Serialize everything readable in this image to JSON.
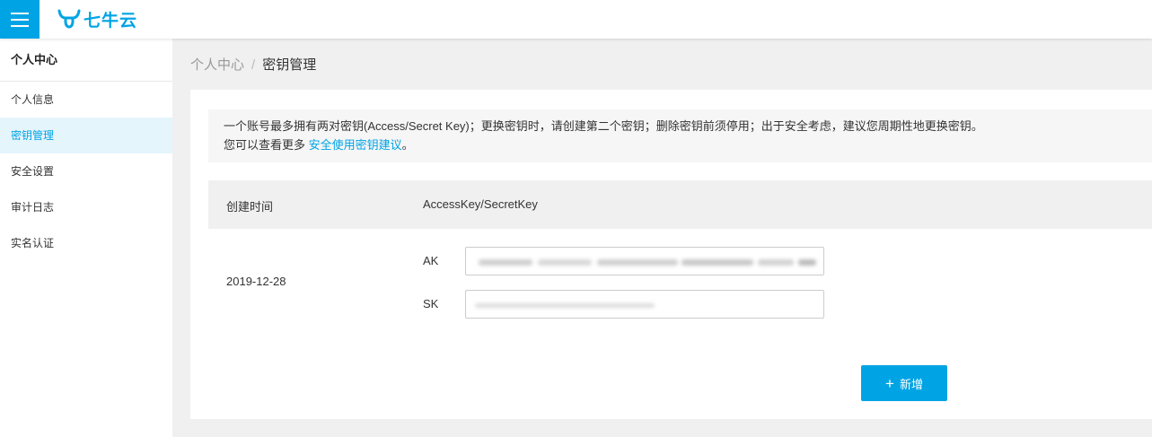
{
  "header": {
    "logo_text": "七牛云",
    "brand_color": "#00a4e4",
    "menu_icon": "hamburger-menu-icon",
    "logo_icon": "bull-head-icon"
  },
  "sidebar": {
    "title": "个人中心",
    "items": [
      {
        "label": "个人信息",
        "active": false
      },
      {
        "label": "密钥管理",
        "active": true
      },
      {
        "label": "安全设置",
        "active": false
      },
      {
        "label": "审计日志",
        "active": false
      },
      {
        "label": "实名认证",
        "active": false
      }
    ]
  },
  "breadcrumb": {
    "parent": "个人中心",
    "separator": "/",
    "current": "密钥管理"
  },
  "notice": {
    "line1": "一个账号最多拥有两对密钥(Access/Secret Key)；更换密钥时，请创建第二个密钥；删除密钥前须停用；出于安全考虑，建议您周期性地更换密钥。",
    "line2_prefix": "您可以查看更多 ",
    "line2_link": "安全使用密钥建议",
    "line2_suffix": "。"
  },
  "table": {
    "headers": [
      "创建时间",
      "AccessKey/SecretKey"
    ],
    "rows": [
      {
        "created": "2019-12-28",
        "ak_label": "AK",
        "sk_label": "SK",
        "ak_value": "",
        "sk_value": ""
      }
    ]
  },
  "actions": {
    "add_icon": "plus-icon",
    "add_label": "新增"
  }
}
